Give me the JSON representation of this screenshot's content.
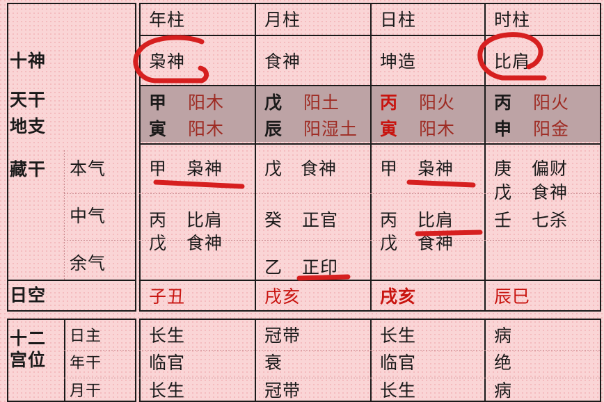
{
  "table": {
    "column_headers": [
      "年柱",
      "月柱",
      "日柱",
      "时柱"
    ],
    "row_labels": {
      "ten_gods": "十神",
      "heavenly_stem": "天干",
      "earthly_branch": "地支",
      "hidden_stems": "藏干",
      "day_void": "日空",
      "twelve_palaces": "十二宫位"
    },
    "hidden_stem_sublabels": [
      "本气",
      "中气",
      "余气"
    ],
    "twelve_palace_sublabels": [
      "日主",
      "年干",
      "月干"
    ]
  },
  "ten_gods_row": [
    "枭神",
    "食神",
    "坤造",
    "比肩"
  ],
  "stems_branches": {
    "heavenly": [
      {
        "char": "甲",
        "element": "阳木"
      },
      {
        "char": "戊",
        "element": "阳土"
      },
      {
        "char": "丙",
        "element": "阳火"
      },
      {
        "char": "丙",
        "element": "阳火"
      }
    ],
    "earthly": [
      {
        "char": "寅",
        "element": "阳木"
      },
      {
        "char": "辰",
        "element": "阳湿土"
      },
      {
        "char": "寅",
        "element": "阳木"
      },
      {
        "char": "申",
        "element": "阳金"
      }
    ]
  },
  "hidden_stems": {
    "year": {
      "本气": {
        "stem": "甲",
        "god": "枭神"
      },
      "中气": {
        "stem": "丙",
        "god": "比肩"
      },
      "中气2": {
        "stem": "戊",
        "god": "食神"
      },
      "余气": {
        "stem": "",
        "god": ""
      }
    },
    "month": {
      "本气": {
        "stem": "戊",
        "god": "食神"
      },
      "中气": {
        "stem": "癸",
        "god": "正官"
      },
      "余气": {
        "stem": "乙",
        "god": "正印"
      }
    },
    "day": {
      "本气": {
        "stem": "甲",
        "god": "枭神"
      },
      "中气": {
        "stem": "丙",
        "god": "比肩"
      },
      "中气2": {
        "stem": "戊",
        "god": "食神"
      },
      "余气": {
        "stem": "",
        "god": ""
      }
    },
    "hour": {
      "本气": {
        "stem": "庚",
        "god": "偏财"
      },
      "本气2": {
        "stem": "戊",
        "god": "食神"
      },
      "中气": {
        "stem": "壬",
        "god": "七杀"
      },
      "余气": {
        "stem": "",
        "god": ""
      }
    }
  },
  "day_void_row": [
    "子丑",
    "戌亥",
    "戌亥",
    "辰巳"
  ],
  "twelve_palaces": {
    "日主": [
      "长生",
      "冠带",
      "长生",
      "病"
    ],
    "年干": [
      "临官",
      "衰",
      "临官",
      "绝"
    ],
    "月干": [
      "长生",
      "冠带",
      "长生",
      "病"
    ]
  },
  "annotations": {
    "color": "#d61f1f",
    "marks": [
      {
        "type": "circle",
        "target": "枭神 (年柱 十神)"
      },
      {
        "type": "circle",
        "target": "比肩 (时柱 十神)"
      },
      {
        "type": "underline",
        "target": "甲 枭神 (年柱 本气)"
      },
      {
        "type": "underline",
        "target": "甲 枭神 (日柱 本气)"
      },
      {
        "type": "underline",
        "target": "丙 比肩 (日柱 中气)"
      },
      {
        "type": "underline",
        "target": "乙 正印 (月柱 余气)"
      }
    ]
  },
  "colors": {
    "background": "#fad5d6",
    "band": "#bda3a5",
    "border": "#1a1a1a",
    "red_text": "#c8140f",
    "maroon_text": "#9e2b23",
    "annotation_red": "#d61f1f"
  }
}
